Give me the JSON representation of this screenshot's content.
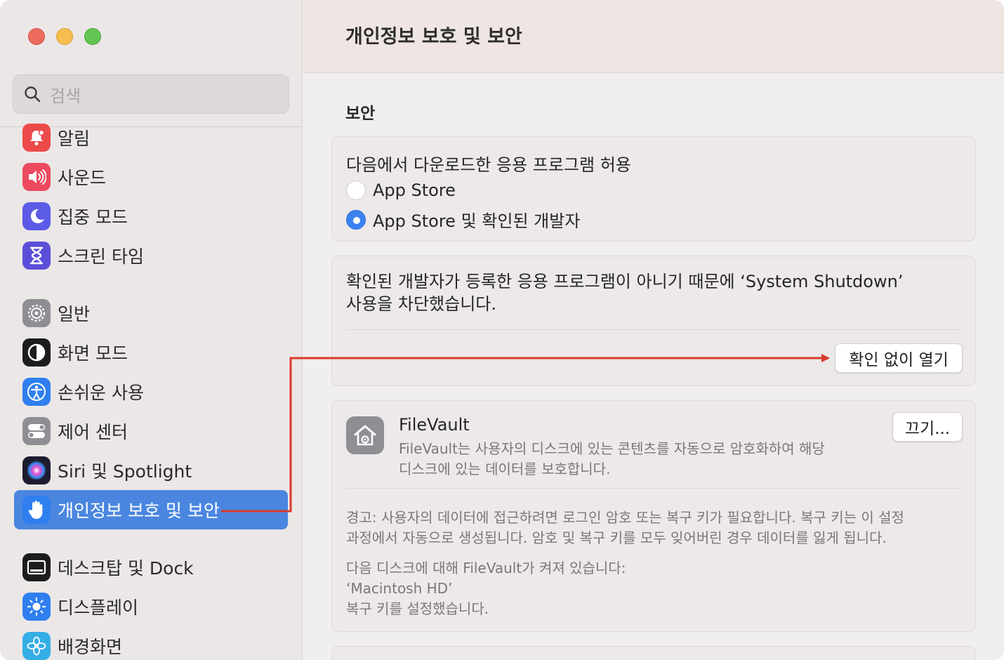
{
  "window": {
    "title": "개인정보 보호 및 보안"
  },
  "sidebar": {
    "search_placeholder": "검색",
    "items": [
      {
        "label": "알림",
        "icon": "bell-icon",
        "color": "#ec4a4a"
      },
      {
        "label": "사운드",
        "icon": "speaker-icon",
        "color": "#ec4a5f"
      },
      {
        "label": "집중 모드",
        "icon": "moon-icon",
        "color": "#5b5be6"
      },
      {
        "label": "스크린 타임",
        "icon": "hourglass-icon",
        "color": "#5b4fd9"
      },
      {
        "label": "일반",
        "icon": "gear-icon",
        "color": "#8e8e93"
      },
      {
        "label": "화면 모드",
        "icon": "appearance-icon",
        "color": "#1c1c1e"
      },
      {
        "label": "손쉬운 사용",
        "icon": "accessibility-icon",
        "color": "#2f7ff0"
      },
      {
        "label": "제어 센터",
        "icon": "toggles-icon",
        "color": "#8e8e93"
      },
      {
        "label": "Siri 및 Spotlight",
        "icon": "siri-icon",
        "color": "#3a2b5e"
      },
      {
        "label": "개인정보 보호 및 보안",
        "icon": "hand-icon",
        "color": "#2f7ff0"
      },
      {
        "label": "데스크탑 및 Dock",
        "icon": "dock-icon",
        "color": "#1c1c1e"
      },
      {
        "label": "디스플레이",
        "icon": "sun-icon",
        "color": "#2f7ff0"
      },
      {
        "label": "배경화면",
        "icon": "flower-icon",
        "color": "#35aee6"
      }
    ],
    "active_item": "개인정보 보호 및 보안"
  },
  "main": {
    "section_title": "보안",
    "downloads": {
      "heading": "다음에서 다운로드한 응용 프로그램 허용",
      "options": [
        {
          "label": "App Store",
          "selected": false
        },
        {
          "label": "App Store 및 확인된 개발자",
          "selected": true
        }
      ]
    },
    "blocked": {
      "message_line1": "확인된 개발자가 등록한 응용 프로그램이 아니기 때문에 ‘System Shutdown’",
      "message_line2": "사용을 차단했습니다.",
      "open_button": "확인 없이 열기"
    },
    "filevault": {
      "title": "FileVault",
      "description_line1": "FileVault는 사용자의 디스크에 있는 콘텐츠를 자동으로 암호화하여 해당",
      "description_line2": "디스크에 있는 데이터를 보호합니다.",
      "off_button": "끄기...",
      "warning_line1": "경고: 사용자의 데이터에 접근하려면 로그인 암호 또는 복구 키가 필요합니다. 복구 키는 이 설정",
      "warning_line2": "과정에서 자동으로 생성됩니다. 암호 및 복구 키를 모두 잊어버린 경우 데이터를 잃게 됩니다.",
      "status_line1": "다음 디스크에 대해 FileVault가 켜져 있습니다:",
      "status_line2": "‘Macintosh HD’",
      "status_line3": "복구 키를 설정했습니다."
    }
  },
  "annotation": {
    "color": "#d93a2b",
    "from": "개인정보 보호 및 보안",
    "to": "확인 없이 열기"
  }
}
